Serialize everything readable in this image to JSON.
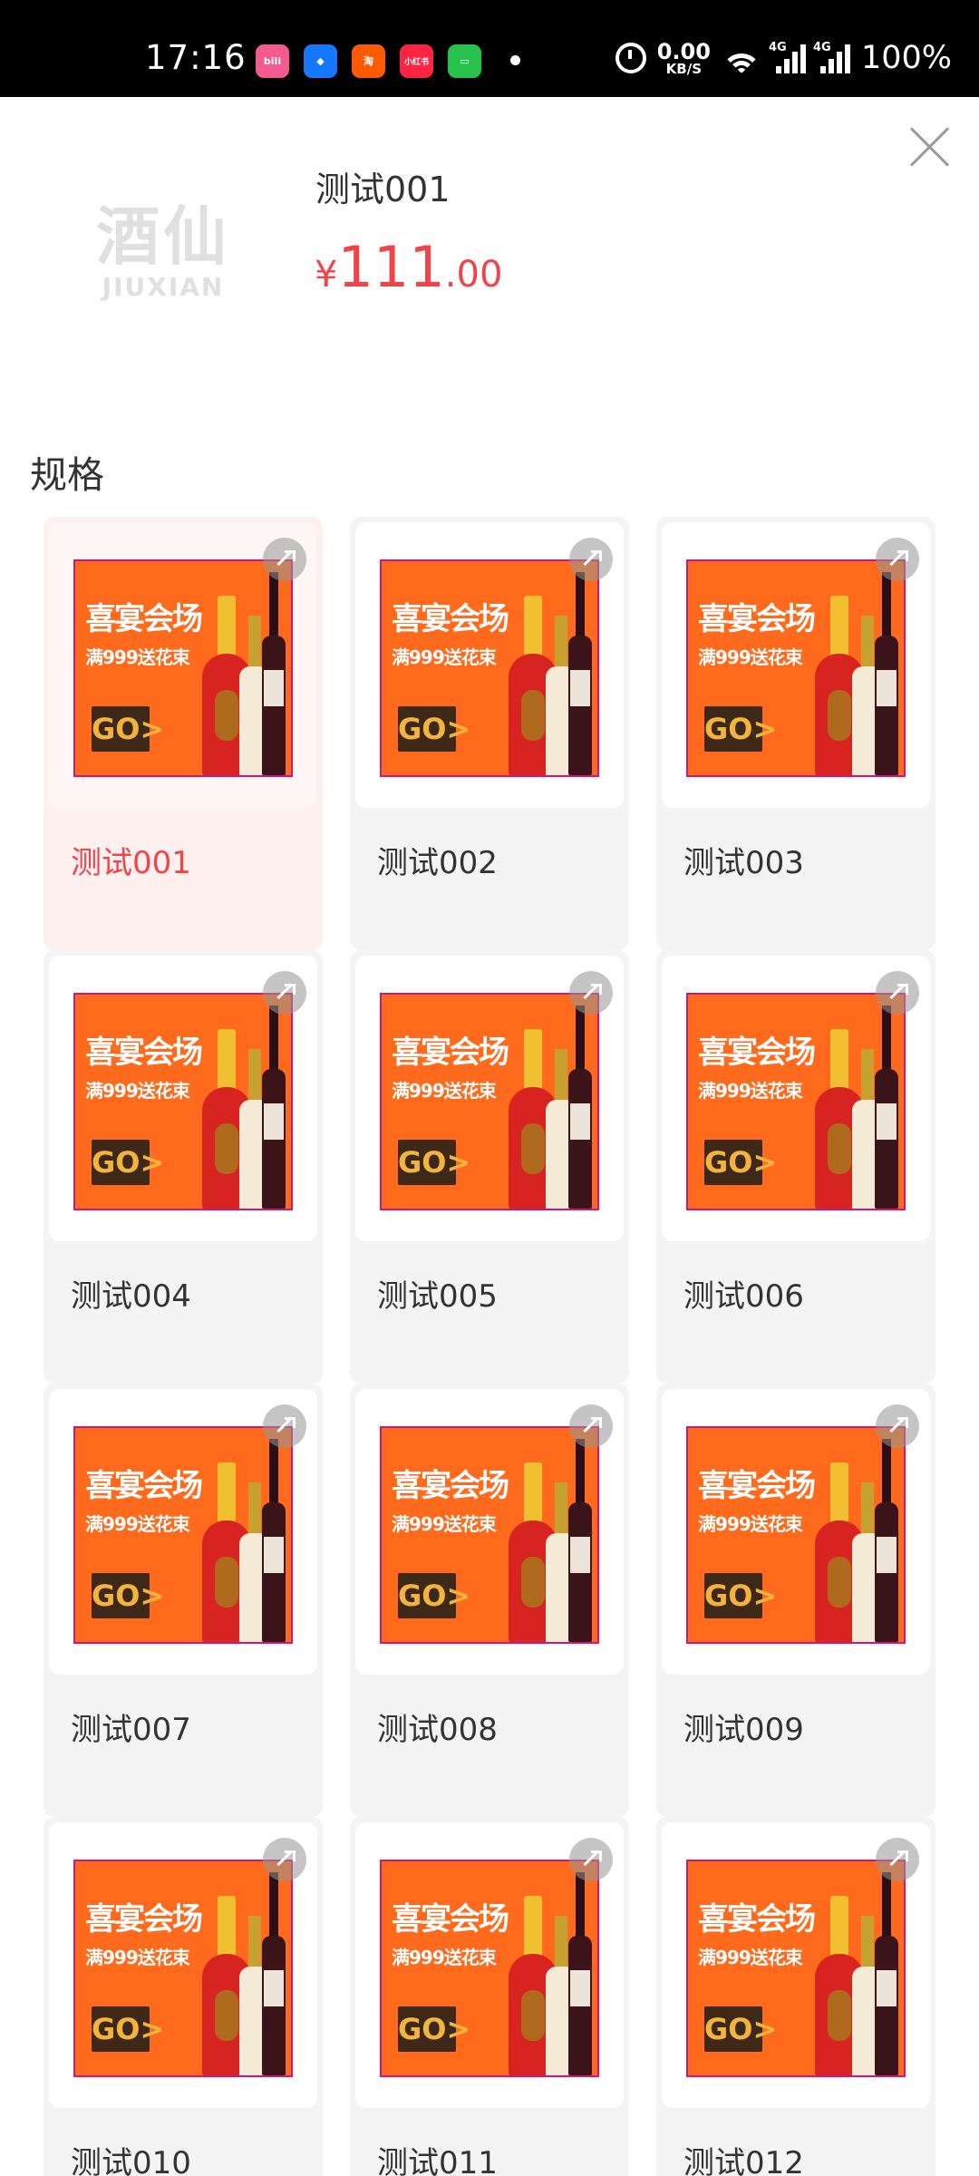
{
  "status_bar": {
    "time": "17:16",
    "apps": [
      {
        "icon": "bilibili-icon",
        "text": "bili",
        "color": "#f45a8d"
      },
      {
        "icon": "alipay-icon",
        "text": "◆",
        "color": "#1677ff"
      },
      {
        "icon": "taobao-icon",
        "text": "淘",
        "color": "#ff5a00"
      },
      {
        "icon": "xiaohongshu-icon",
        "text": "小红书",
        "color": "#ff2442"
      },
      {
        "icon": "messages-icon",
        "text": "▭",
        "color": "#27c24c"
      }
    ],
    "speed_value": "0.00",
    "speed_unit": "KB/S",
    "network_1": "4G",
    "network_2": "4G",
    "battery": "100%"
  },
  "header": {
    "logo_cn": "酒仙",
    "logo_en": "JIUXIAN",
    "product_name": "测试001",
    "price_currency": "¥",
    "price_integer": "111",
    "price_decimal": ".00"
  },
  "spec": {
    "label": "规格",
    "selected_index": 0,
    "banner_title": "喜宴会场",
    "banner_subtitle": "满999送花束",
    "banner_go": "GO>",
    "items": [
      {
        "label": "测试001"
      },
      {
        "label": "测试002"
      },
      {
        "label": "测试003"
      },
      {
        "label": "测试004"
      },
      {
        "label": "测试005"
      },
      {
        "label": "测试006"
      },
      {
        "label": "测试007"
      },
      {
        "label": "测试008"
      },
      {
        "label": "测试009"
      },
      {
        "label": "测试010"
      },
      {
        "label": "测试011"
      },
      {
        "label": "测试012"
      }
    ]
  },
  "colors": {
    "accent": "#f0434a",
    "banner": "#ff6a1c",
    "card_bg": "#f4f4f4",
    "selected_bg": "#fff0f0"
  }
}
